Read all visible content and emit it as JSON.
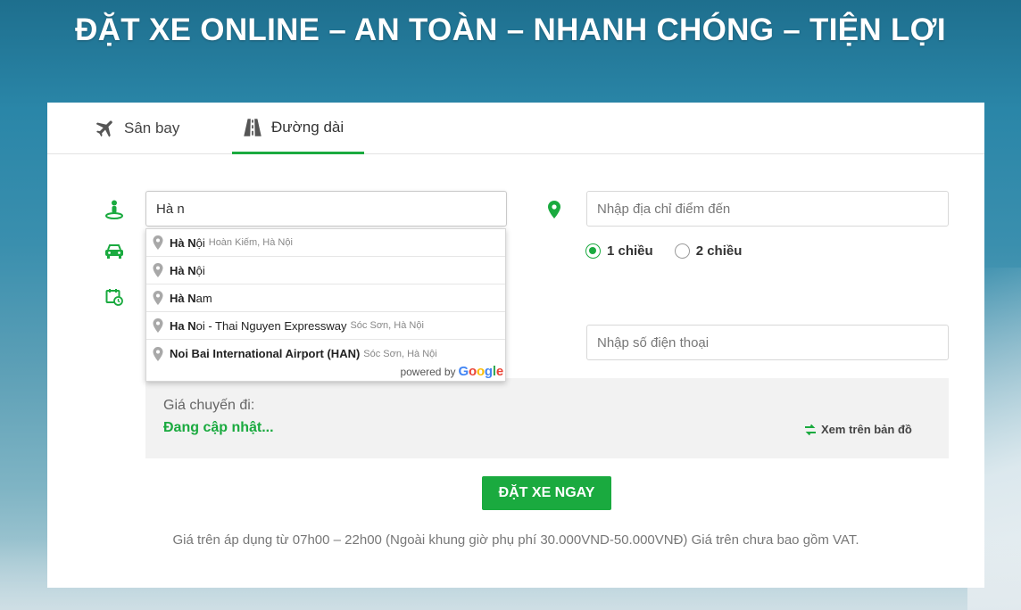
{
  "headline": "ĐẶT XE ONLINE – AN TOÀN – NHANH CHÓNG – TIỆN LỢI",
  "tabs": [
    {
      "label": "Sân bay",
      "icon": "airplane-icon",
      "active": false
    },
    {
      "label": "Đường dài",
      "icon": "road-icon",
      "active": true
    }
  ],
  "form": {
    "origin": {
      "value": "Hà n",
      "icon": "pickup-person-icon"
    },
    "destination": {
      "placeholder": "Nhập địa chỉ điểm đến",
      "icon": "map-pin-icon"
    },
    "phone": {
      "placeholder": "Nhập số điện thoại"
    },
    "car_icon": "car-icon",
    "calendar_icon": "calendar-clock-icon",
    "trip_type": {
      "options": [
        "1 chiều",
        "2 chiều"
      ],
      "selected": "1 chiều"
    }
  },
  "suggestions": {
    "items": [
      {
        "match": "Hà N",
        "rest": "ội",
        "secondary": "Hoàn Kiếm, Hà Nội"
      },
      {
        "match": "Hà N",
        "rest": "ội",
        "secondary": ""
      },
      {
        "match": "Hà N",
        "rest": "am",
        "secondary": ""
      },
      {
        "match": "Ha N",
        "rest": "oi - Thai Nguyen Expressway",
        "secondary": "Sóc Sơn, Hà Nội"
      },
      {
        "match": "Noi Bai International Airport (HAN)",
        "rest": "",
        "secondary": "Sóc Sơn, Hà Nội"
      }
    ],
    "powered_by": "powered by",
    "brand": "Google"
  },
  "price": {
    "label": "Giá chuyến đi:",
    "value": "Đang cập nhật...",
    "map_link": "Xem trên bản đồ"
  },
  "book_button": "ĐẶT XE NGAY",
  "note": "Giá trên áp dụng từ 07h00 – 22h00 (Ngoài khung giờ phụ phí 30.000VND-50.000VNĐ) Giá trên chưa bao gồm VAT.",
  "colors": {
    "accent": "#1aaa3f"
  }
}
